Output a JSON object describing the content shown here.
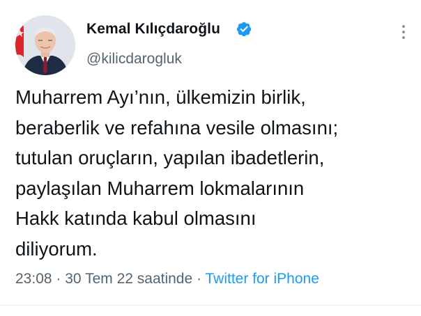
{
  "author": {
    "name": "Kemal Kılıçdaroğlu",
    "handle": "@kilicdarogluk",
    "avatar_icon": "profile-photo",
    "verified_icon": "verified-badge-icon",
    "verified_color": "#1d9bf0"
  },
  "menu_icon": "more-options-icon",
  "tweet": {
    "lines": [
      "Muharrem Ayı’nın, ülkemizin birlik,",
      "beraberlik ve refahına vesile olmasını;",
      "tutulan oruçların, yapılan ibadetlerin,",
      "paylaşılan Muharrem lokmalarının",
      "Hakk katında kabul olmasını",
      "diliyorum."
    ]
  },
  "meta": {
    "time": "23:08",
    "separator": "·",
    "date": "30 Tem 22 saatinde",
    "source": "Twitter for iPhone"
  },
  "colors": {
    "text": "#0f1419",
    "secondary": "#536471",
    "link": "#1d9bf0"
  }
}
